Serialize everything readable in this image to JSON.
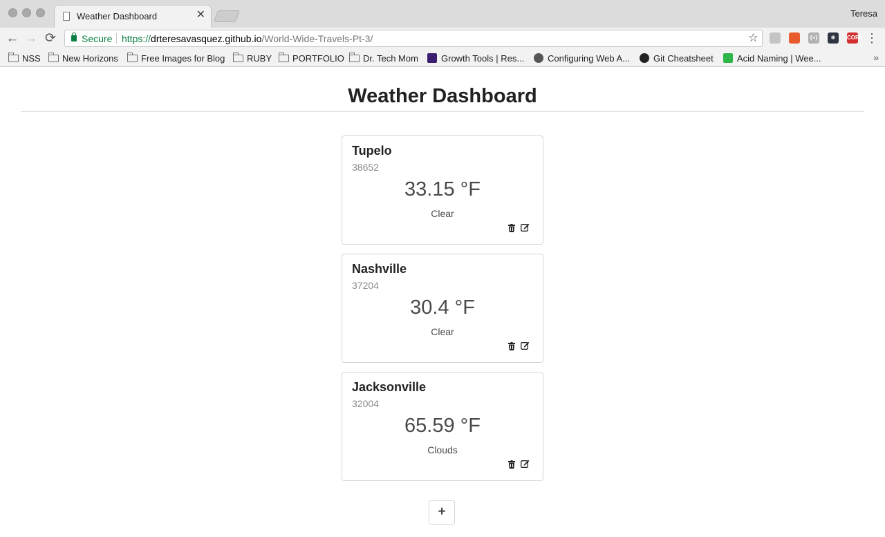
{
  "browser": {
    "tab_title": "Weather Dashboard",
    "tab_close": "✕",
    "profile_name": "Teresa",
    "back": "←",
    "forward": "→",
    "reload": "⟳",
    "secure_label": "Secure",
    "url": {
      "scheme": "https://",
      "domain": "drteresavasquez.github.io",
      "path": "/World-Wide-Travels-Pt-3/"
    },
    "bookmark_star": "☆",
    "menu": "⋮",
    "extensions": [
      {
        "name": "drive-extension-icon",
        "label": "",
        "color": "#c4c4c4"
      },
      {
        "name": "stack-extension-icon",
        "label": "",
        "color": "#e95a2c"
      },
      {
        "name": "json-extension-icon",
        "label": "{≡}",
        "color": "#b0b0b0"
      },
      {
        "name": "react-devtools-icon",
        "label": "⚛",
        "color": "#2f3542"
      },
      {
        "name": "cors-extension-icon",
        "label": "CORS",
        "color": "#d32f2f"
      }
    ]
  },
  "bookmarks": {
    "items": [
      {
        "label": "NSS",
        "icon": "folder"
      },
      {
        "label": "New Horizons",
        "icon": "folder"
      },
      {
        "label": "Free Images for Blog",
        "icon": "folder"
      },
      {
        "label": "RUBY",
        "icon": "folder"
      },
      {
        "label": "PORTFOLIO",
        "icon": "folder"
      },
      {
        "label": "Dr. Tech Mom",
        "icon": "folder"
      },
      {
        "label": "Growth Tools | Res...",
        "icon": "growth-tools"
      },
      {
        "label": "Configuring Web A...",
        "icon": "apple"
      },
      {
        "label": "Git Cheatsheet",
        "icon": "github"
      },
      {
        "label": "Acid Naming | Wee...",
        "icon": "acid"
      }
    ],
    "more": "»"
  },
  "page": {
    "title": "Weather Dashboard",
    "cards": [
      {
        "city": "Tupelo",
        "zip": "38652",
        "temp": "33.15 °F",
        "condition": "Clear"
      },
      {
        "city": "Nashville",
        "zip": "37204",
        "temp": "30.4 °F",
        "condition": "Clear"
      },
      {
        "city": "Jacksonville",
        "zip": "32004",
        "temp": "65.59 °F",
        "condition": "Clouds"
      }
    ],
    "add_label": "+"
  },
  "colors": {
    "secure_green": "#0b8043",
    "card_border": "#d6d6d6",
    "heading": "#212121"
  }
}
